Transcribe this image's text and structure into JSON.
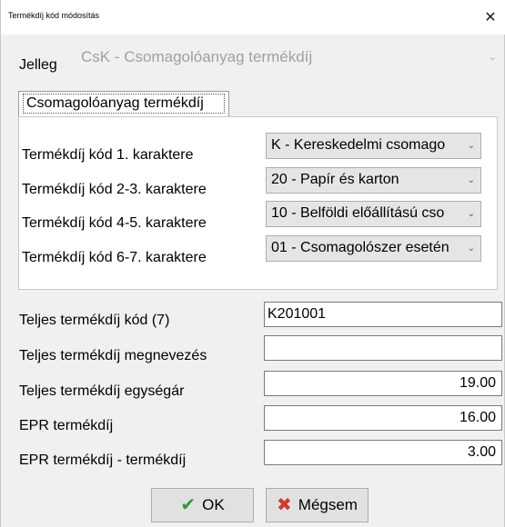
{
  "window": {
    "title": "Termékdíj kód módosítás",
    "close_glyph": "✕"
  },
  "jelleg": {
    "label": "Jelleg",
    "value": "CsK - Csomagolóanyag termékdíj",
    "enabled": false
  },
  "tab": {
    "label": "Csomagolóanyag termékdíj"
  },
  "code_chars": [
    {
      "label": "Termékdíj kód 1. karaktere",
      "value": "K - Kereskedelmi csomago"
    },
    {
      "label": "Termékdíj kód 2-3. karaktere",
      "value": "20 - Papír és karton"
    },
    {
      "label": "Termékdíj kód 4-5. karaktere",
      "value": "10 - Belföldi előállítású cso"
    },
    {
      "label": "Termékdíj kód 6-7. karaktere",
      "value": "01 - Csomagolószer esetén"
    }
  ],
  "fields": {
    "full_code": {
      "label": "Teljes termékdíj kód (7)",
      "value": "K201001"
    },
    "full_name": {
      "label": "Teljes termékdíj megnevezés",
      "value": ""
    },
    "unit_price": {
      "label": "Teljes termékdíj egységár",
      "value": "19.00"
    },
    "epr_fee": {
      "label": "EPR termékdíj",
      "value": "16.00"
    },
    "epr_diff": {
      "label": "EPR termékdíj - termékdíj",
      "value": "3.00"
    }
  },
  "buttons": {
    "ok": {
      "label": "OK",
      "icon": "checkmark-icon"
    },
    "cancel": {
      "label": "Mégsem",
      "icon": "x-mark-icon"
    }
  },
  "colors": {
    "ok_icon": "#2e9a3c",
    "cancel_icon": "#d23a2a",
    "disabled_text": "#a0a0a0"
  }
}
